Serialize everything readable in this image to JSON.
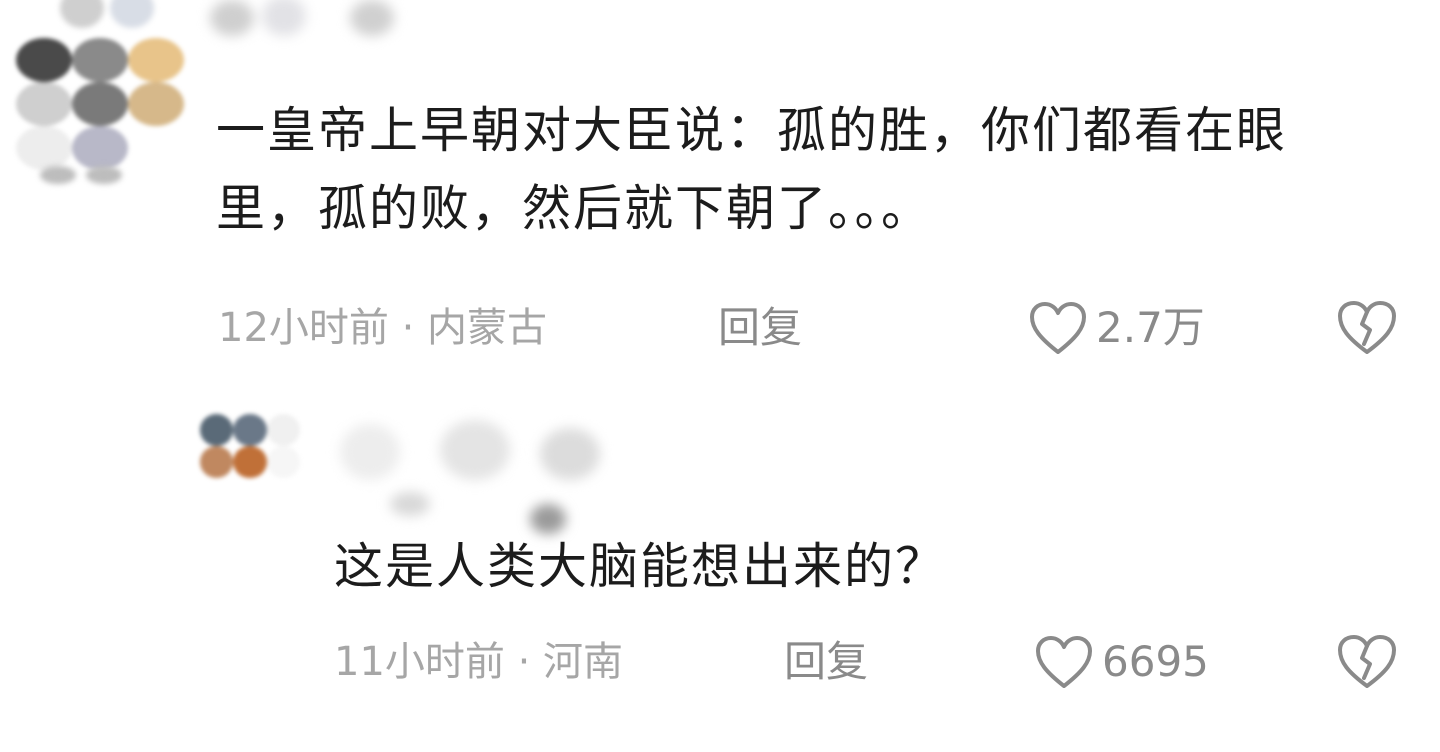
{
  "comments": [
    {
      "text": "一皇帝上早朝对大臣说：孤的胜，你们都看在眼里，孤的败，然后就下朝了。。。",
      "meta": "12小时前 · 内蒙古",
      "reply_label": "回复",
      "like_count": "2.7万",
      "avatar_colors": [
        "#4a4a4a",
        "#8a8a8a",
        "#e8c48a",
        "#cfcfcf",
        "#7a7a7a",
        "#d6b88a",
        "#ededed",
        "#b8b8c8",
        "#ffffff"
      ]
    },
    {
      "text": "这是人类大脑能想出来的？",
      "meta": "11小时前 · 河南",
      "reply_label": "回复",
      "like_count": "6695",
      "avatar_colors": [
        "#5a6a78",
        "#6a7888",
        "#f0f0f0",
        "#c08860",
        "#c07038",
        "#f6f6f6",
        "#ffffff",
        "#ffffff",
        "#ffffff"
      ]
    }
  ],
  "icons": {
    "like": "heart-outline-icon",
    "dislike": "broken-heart-icon"
  },
  "colors": {
    "icon_stroke": "#8a8a8a",
    "meta_text": "#a6a6a6",
    "body_text": "#1c1c1c"
  }
}
